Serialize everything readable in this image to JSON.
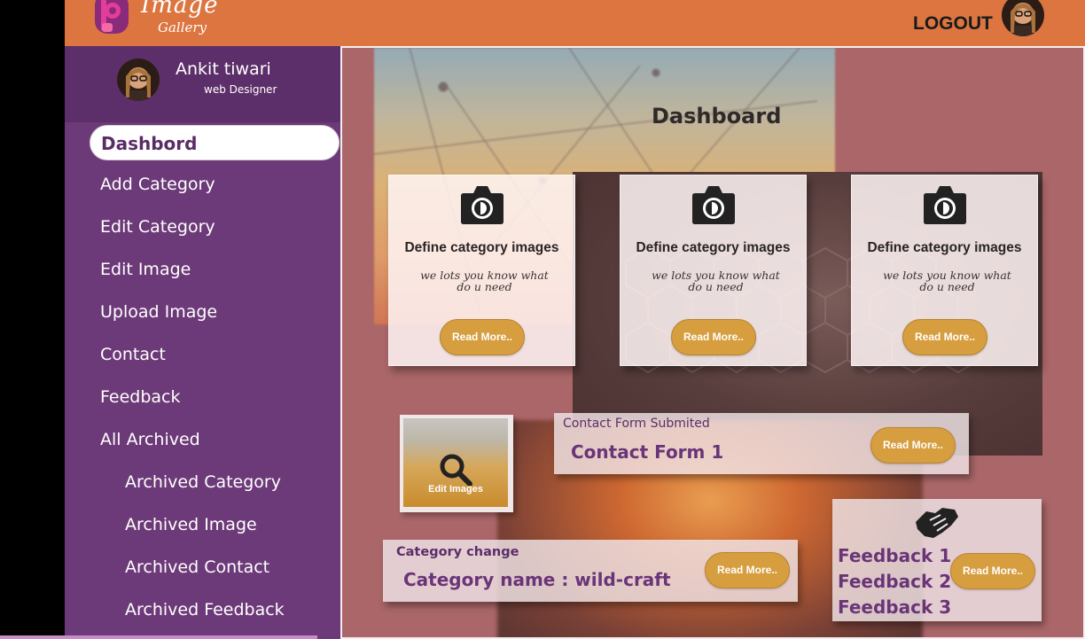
{
  "header": {
    "logo_title": "Image",
    "logo_subtitle": "Gallery",
    "logout_label": "LOGOUT"
  },
  "profile": {
    "name": "Ankit tiwari",
    "role": "web Designer"
  },
  "sidebar": {
    "items": [
      {
        "label": "Dashbord"
      },
      {
        "label": "Add Category"
      },
      {
        "label": "Edit Category"
      },
      {
        "label": "Edit Image"
      },
      {
        "label": "Upload Image"
      },
      {
        "label": "Contact"
      },
      {
        "label": "Feedback"
      },
      {
        "label": "All Archived"
      },
      {
        "label": "Archived Category"
      },
      {
        "label": "Archived Image"
      },
      {
        "label": "Archived Contact"
      },
      {
        "label": "Archived Feedback"
      }
    ]
  },
  "main": {
    "title": "Dashboard",
    "cards": [
      {
        "title": "Define category images",
        "text": "we lots you know what do u need",
        "button": "Read More.."
      },
      {
        "title": "Define category images",
        "text": "we lots you know what do u need",
        "button": "Read More.."
      },
      {
        "title": "Define category images",
        "text": "we lots you know what do u need",
        "button": "Read More.."
      }
    ],
    "edit_images_label": "Edit Images",
    "contact": {
      "label": "Contact Form Submited",
      "value": "Contact Form 1",
      "button": "Read More.."
    },
    "category": {
      "label": "Category  change",
      "value": "Category name :   wild-craft",
      "button": "Read More.."
    },
    "feedback": {
      "items": [
        "Feedback 1",
        "Feedback 2",
        "Feedback 3"
      ],
      "button": "Read More.."
    }
  },
  "icons": {
    "logo": "image-gallery-logo-icon",
    "avatar": "user-avatar",
    "camera": "camera-icon",
    "search": "search-icon",
    "handshake": "handshake-icon"
  },
  "colors": {
    "header": "#dd7540",
    "sidebar": "#6c3a78",
    "accent_button": "#d69e3e",
    "main_bg": "#aa6769"
  }
}
